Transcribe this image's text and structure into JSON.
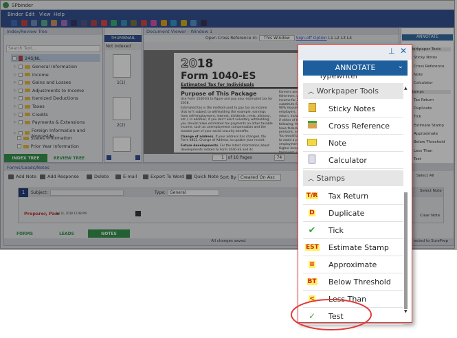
{
  "app": {
    "title": "SPbinder",
    "menu": [
      "Binder",
      "Edit",
      "View",
      "Help"
    ]
  },
  "index_tree": {
    "title": "Index/Review Tree",
    "search_placeholder": "Search Text...",
    "root": "24SJNL",
    "items": [
      "General Information",
      "Income",
      "Gains and Losses",
      "Adjustments to Income",
      "Itemized Deductions",
      "Taxes",
      "Credits",
      "Payments & Extensions",
      "Foreign Information and Nonreside",
      "States Information",
      "Prior Year Information"
    ],
    "tabs": [
      "INDEX TREE",
      "REVIEW TREE"
    ]
  },
  "doc_viewer": {
    "title": "Document Viewer - Window 1",
    "thumbnail_tab": "THUMBNAIL",
    "filter": "Not Indexed",
    "thumbs": [
      "1(1)",
      "2(2)"
    ],
    "xref_label": "Open Cross Reference in:",
    "xref_value": "This Window",
    "signoff": "Sign-off Option",
    "levels": [
      "L1",
      "L2",
      "L3",
      "L4"
    ],
    "page": "1",
    "of": "of",
    "pages": "16 Pages",
    "zoom": "74",
    "doc": {
      "year_outline": "20",
      "year_bold": "18",
      "form": "Form 1040-ES",
      "subtitle": "Estimated Tax for Individuals",
      "h1": "Purpose of This Package",
      "p1": "Use Form 1040-ES to figure and pay your estimated tax for 2018.",
      "p2": "Estimated tax is the method used to pay tax on income that isn't subject to withholding (for example, earnings from self-employment, interest, dividends, rents, alimony, etc.). In addition, if you don't elect voluntary withholding, you should make estimated tax payments on other taxable income, such as unemployment compensation and the taxable part of your social security benefits.",
      "h2": "Change of address.",
      "p3": "If your address has changed, file Form 8822, Change of Address, to update your record.",
      "h3": "Future developments.",
      "p4": "For the latest information about developments related to Form 1040-ES and its",
      "c2": "Farmers and fishermen. gross income for 2017 substitute 66⅔% for 90% Household employers. 2018 tax return, include taxes if either of the following: You will have federal pensions, annuities... You would be required to avoid a penalty. employment taxes. Higher income taxpayers. income (AGI) for 2017 if your filing status is substitute 110% for 100%"
    }
  },
  "forms": {
    "title": "Forms/Leads/Notes",
    "toolbar": [
      "Add Note",
      "Add Response",
      "Delete",
      "E-mail",
      "Export To Word",
      "Quick Note"
    ],
    "sort_label": "Sort By",
    "sort_value": "Created On Asc",
    "note_num": "1",
    "subject_label": "Subject:",
    "type_label": "Type:",
    "type_value": "General",
    "author": "Preparer, Pam",
    "date": "Jul 31, 2018 12:48 PM",
    "select_all": "Select All",
    "select_note": "Select Note",
    "clear_note": "Clear Note",
    "tabs": [
      "FORMS",
      "LEADS",
      "NOTES"
    ],
    "status": "All changes saved.",
    "connected": "ected to SurePrep"
  },
  "annotate_small": {
    "title": "ANNOTATE",
    "sections": [
      "Workpaper Tools",
      "Stamps"
    ],
    "tools": [
      "Sticky Notes",
      "Cross Reference",
      "Note",
      "Calculator"
    ],
    "stamps": [
      "Tax Return",
      "Duplicate",
      "Tick",
      "Estimate Stamp",
      "Approximate",
      "Below Threshold",
      "Less Than",
      "Test"
    ]
  },
  "popup": {
    "title": "ANNOTATE",
    "partial_item": "Typewriter",
    "sections": [
      "Workpaper Tools",
      "Stamps"
    ],
    "tools": [
      {
        "label": "Sticky Notes",
        "icon": "sticky-notes-icon"
      },
      {
        "label": "Cross Reference",
        "icon": "cross-reference-icon"
      },
      {
        "label": "Note",
        "icon": "note-icon"
      },
      {
        "label": "Calculator",
        "icon": "calculator-icon"
      }
    ],
    "stamps": [
      {
        "label": "Tax Return",
        "badge": "T/R"
      },
      {
        "label": "Duplicate",
        "badge": "D"
      },
      {
        "label": "Tick",
        "badge": "✔"
      },
      {
        "label": "Estimate Stamp",
        "badge": "EST"
      },
      {
        "label": "Approximate",
        "badge": "≅"
      },
      {
        "label": "Below Threshold",
        "badge": "BT"
      },
      {
        "label": "Less Than",
        "badge": "<"
      },
      {
        "label": "Test",
        "badge": "✓"
      }
    ]
  },
  "colors": {
    "navy": "#1e3f86",
    "annotate": "#1f5e9c",
    "green_tab": "#1f8a3a",
    "highlight": "#e03a3a"
  }
}
